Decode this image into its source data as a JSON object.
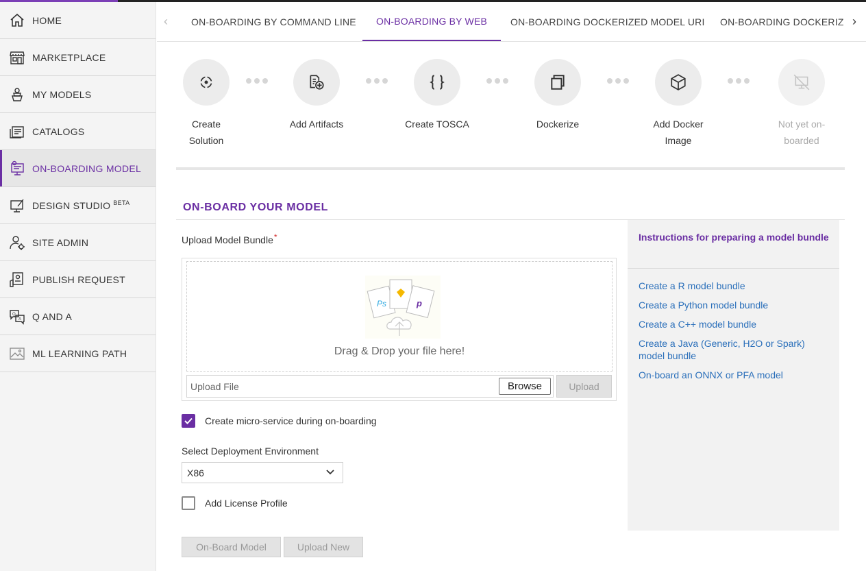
{
  "sidebar": {
    "items": [
      {
        "label": "HOME",
        "icon": "home-icon"
      },
      {
        "label": "MARKETPLACE",
        "icon": "storefront-icon"
      },
      {
        "label": "MY MODELS",
        "icon": "models-icon"
      },
      {
        "label": "CATALOGS",
        "icon": "catalog-icon"
      },
      {
        "label": "ON-BOARDING MODEL",
        "icon": "onboarding-icon"
      },
      {
        "label": "DESIGN STUDIO",
        "badge": "BETA",
        "icon": "design-studio-icon"
      },
      {
        "label": "SITE ADMIN",
        "icon": "admin-icon"
      },
      {
        "label": "PUBLISH REQUEST",
        "icon": "publish-icon"
      },
      {
        "label": "Q AND A",
        "icon": "qanda-icon"
      },
      {
        "label": "ML LEARNING PATH",
        "icon": "learning-path-icon"
      }
    ],
    "active": "ON-BOARDING MODEL"
  },
  "tabs": {
    "items": [
      {
        "label": "ON-BOARDING BY COMMAND LINE"
      },
      {
        "label": "ON-BOARDING BY WEB"
      },
      {
        "label": "ON-BOARDING DOCKERIZED MODEL URI"
      },
      {
        "label": "ON-BOARDING DOCKERIZED"
      }
    ],
    "active": "ON-BOARDING BY WEB"
  },
  "steps": [
    {
      "label": "Create Solution",
      "icon": "target-icon"
    },
    {
      "label": "Add Artifacts",
      "icon": "add-file-icon"
    },
    {
      "label": "Create TOSCA",
      "icon": "braces-icon"
    },
    {
      "label": "Dockerize",
      "icon": "copy-icon"
    },
    {
      "label": "Add Docker Image",
      "icon": "cube-icon"
    },
    {
      "label": "Not yet on-boarded",
      "icon": "not-onboarded-icon"
    }
  ],
  "section": {
    "title": "ON-BOARD YOUR MODEL"
  },
  "upload": {
    "label": "Upload Model Bundle",
    "required_mark": "*",
    "drop_text": "Drag & Drop your file here!",
    "file_placeholder": "Upload File",
    "browse_label": "Browse",
    "upload_label": "Upload"
  },
  "microservice": {
    "label": "Create micro-service during on-boarding",
    "checked": true
  },
  "deployment": {
    "label": "Select Deployment Environment",
    "value": "X86"
  },
  "license": {
    "label": "Add License Profile",
    "checked": false
  },
  "actions": {
    "onboard_label": "On-Board Model",
    "upload_new_label": "Upload New"
  },
  "instructions": {
    "title": "Instructions for preparing a model bundle",
    "links": [
      "Create a R model bundle",
      "Create a Python model bundle",
      "Create a C++ model bundle",
      "Create a Java (Generic, H2O or Spark) model bundle",
      "On-board an ONNX or PFA model"
    ]
  },
  "colors": {
    "accent": "#6a2ea3",
    "link": "#2a6fba",
    "required": "#d32f2f"
  }
}
